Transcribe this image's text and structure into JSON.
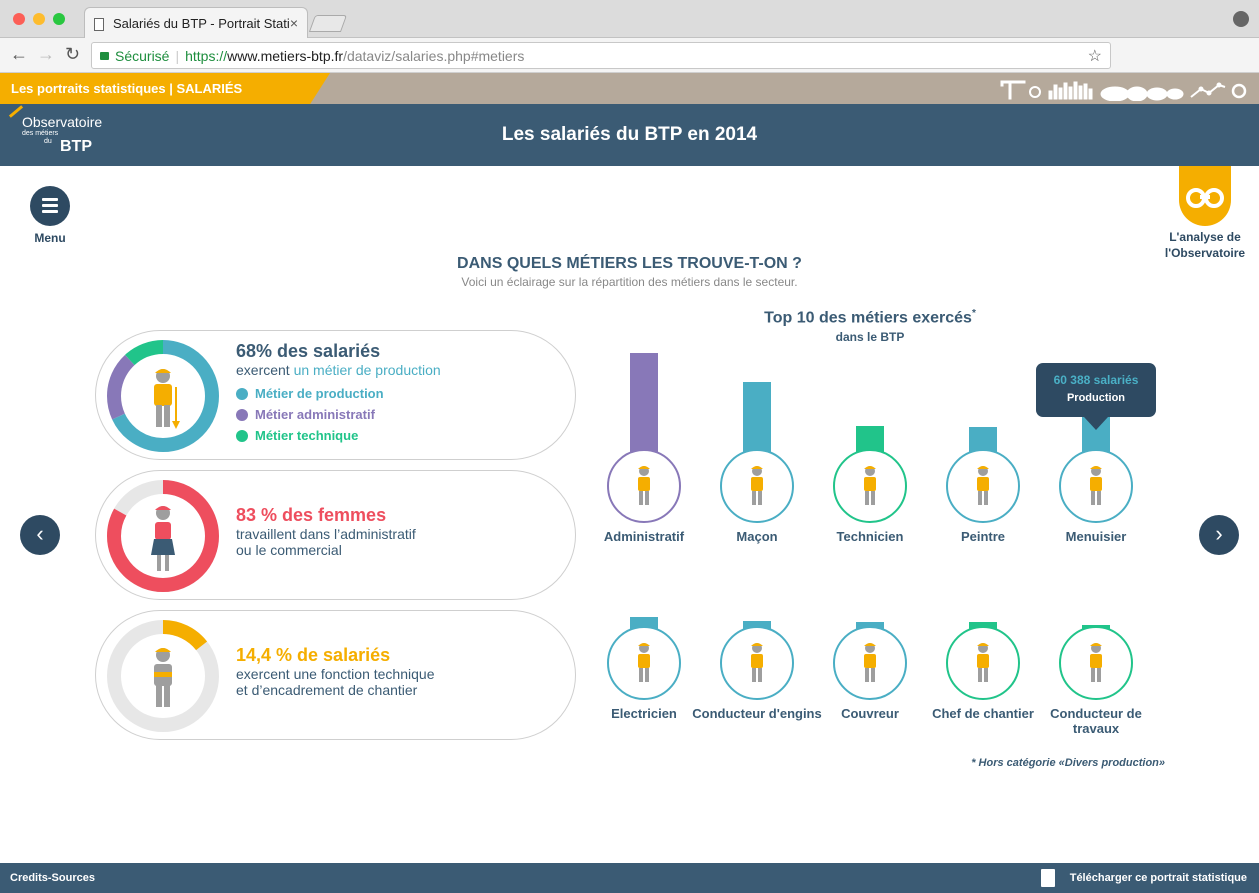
{
  "browser": {
    "tab_title": "Salariés du BTP - Portrait Stati",
    "secure_label": "Sécurisé",
    "url_scheme": "https://",
    "url_host": "www.metiers-btp.fr",
    "url_path": "/dataviz/salaries.php#metiers"
  },
  "site": {
    "strip_label": "Les portraits statistiques | SALARIÉS",
    "logo_line1": "Observatoire",
    "logo_line2": "des métiers",
    "logo_line3": "du",
    "logo_line4": "BTP",
    "page_title": "Les salariés du BTP en 2014",
    "menu_label": "Menu",
    "analyse_label": "L'analyse de l'Observatoire"
  },
  "section": {
    "title": "DANS QUELS MÉTIERS LES TROUVE-T-ON ?",
    "subtitle": "Voici un éclairage sur la répartition des métiers dans le secteur."
  },
  "cards": [
    {
      "big": "68% des salariés",
      "line1_prefix": "exercent ",
      "line1_highlight": "un métier de production",
      "legend": [
        {
          "label": "Métier de production",
          "color": "#4aaec4"
        },
        {
          "label": "Métier administratif",
          "color": "#8878b8"
        },
        {
          "label": "Métier technique",
          "color": "#21c48a"
        }
      ],
      "donut": [
        0.68,
        0.2,
        0.12
      ],
      "big_color": "#3b5b74"
    },
    {
      "big": "83 % des femmes",
      "line1": "travaillent dans l’administratif",
      "line2": "ou le commercial",
      "donut_fraction": 0.83,
      "big_color": "#ee4e5e"
    },
    {
      "big": "14,4 % de salariés",
      "line1": "exercent une fonction technique",
      "line2": "et d’encadrement de chantier",
      "donut_fraction": 0.144,
      "big_color": "#f5ae00"
    }
  ],
  "chart_data": {
    "type": "bar",
    "title": "Top 10 des métiers exercés",
    "title_mark": "*",
    "subtitle": "dans le BTP",
    "categories": [
      "Administratif",
      "Maçon",
      "Technicien",
      "Peintre",
      "Menuisier",
      "Electricien",
      "Conducteur d'engins",
      "Couvreur",
      "Chef de chantier",
      "Conducteur de travaux"
    ],
    "values": [
      108000,
      79000,
      35000,
      34000,
      60388,
      33000,
      27000,
      25000,
      25000,
      20000
    ],
    "categories_type": [
      "Administratif",
      "Production",
      "Technique",
      "Production",
      "Production",
      "Production",
      "Production",
      "Production",
      "Technique",
      "Technique"
    ],
    "type_colors": {
      "Production": "#4aaec4",
      "Administratif": "#8878b8",
      "Technique": "#21c48a"
    },
    "tooltip": {
      "value": "60 388 salariés",
      "category": "Production"
    },
    "footnote": "* Hors catégorie «Divers production»"
  },
  "footer": {
    "credits": "Credits-Sources",
    "download": "Télécharger ce portrait statistique"
  }
}
